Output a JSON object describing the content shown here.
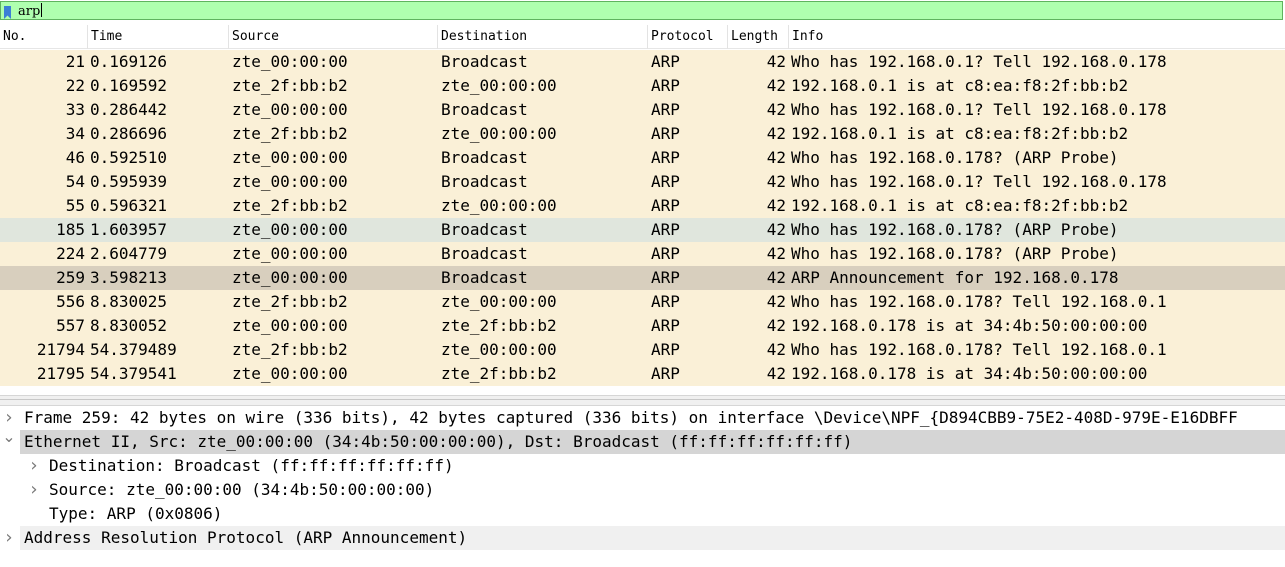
{
  "filter": {
    "value": "arp",
    "bookmark_icon": "bookmark-icon"
  },
  "packet_list": {
    "columns": [
      "No.",
      "Time",
      "Source",
      "Destination",
      "Protocol",
      "Length",
      "Info"
    ],
    "rows": [
      {
        "no": "21",
        "time": "0.169126",
        "src": "zte_00:00:00",
        "dst": "Broadcast",
        "proto": "ARP",
        "len": "42",
        "info": "Who has 192.168.0.1? Tell 192.168.0.178"
      },
      {
        "no": "22",
        "time": "0.169592",
        "src": "zte_2f:bb:b2",
        "dst": "zte_00:00:00",
        "proto": "ARP",
        "len": "42",
        "info": "192.168.0.1 is at c8:ea:f8:2f:bb:b2"
      },
      {
        "no": "33",
        "time": "0.286442",
        "src": "zte_00:00:00",
        "dst": "Broadcast",
        "proto": "ARP",
        "len": "42",
        "info": "Who has 192.168.0.1? Tell 192.168.0.178"
      },
      {
        "no": "34",
        "time": "0.286696",
        "src": "zte_2f:bb:b2",
        "dst": "zte_00:00:00",
        "proto": "ARP",
        "len": "42",
        "info": "192.168.0.1 is at c8:ea:f8:2f:bb:b2"
      },
      {
        "no": "46",
        "time": "0.592510",
        "src": "zte_00:00:00",
        "dst": "Broadcast",
        "proto": "ARP",
        "len": "42",
        "info": "Who has 192.168.0.178? (ARP Probe)"
      },
      {
        "no": "54",
        "time": "0.595939",
        "src": "zte_00:00:00",
        "dst": "Broadcast",
        "proto": "ARP",
        "len": "42",
        "info": "Who has 192.168.0.1? Tell 192.168.0.178"
      },
      {
        "no": "55",
        "time": "0.596321",
        "src": "zte_2f:bb:b2",
        "dst": "zte_00:00:00",
        "proto": "ARP",
        "len": "42",
        "info": "192.168.0.1 is at c8:ea:f8:2f:bb:b2"
      },
      {
        "no": "185",
        "time": "1.603957",
        "src": "zte_00:00:00",
        "dst": "Broadcast",
        "proto": "ARP",
        "len": "42",
        "info": "Who has 192.168.0.178? (ARP Probe)",
        "style": "hl-blue"
      },
      {
        "no": "224",
        "time": "2.604779",
        "src": "zte_00:00:00",
        "dst": "Broadcast",
        "proto": "ARP",
        "len": "42",
        "info": "Who has 192.168.0.178? (ARP Probe)"
      },
      {
        "no": "259",
        "time": "3.598213",
        "src": "zte_00:00:00",
        "dst": "Broadcast",
        "proto": "ARP",
        "len": "42",
        "info": "ARP Announcement for 192.168.0.178",
        "style": "selected"
      },
      {
        "no": "556",
        "time": "8.830025",
        "src": "zte_2f:bb:b2",
        "dst": "zte_00:00:00",
        "proto": "ARP",
        "len": "42",
        "info": "Who has 192.168.0.178? Tell 192.168.0.1"
      },
      {
        "no": "557",
        "time": "8.830052",
        "src": "zte_00:00:00",
        "dst": "zte_2f:bb:b2",
        "proto": "ARP",
        "len": "42",
        "info": "192.168.0.178 is at 34:4b:50:00:00:00"
      },
      {
        "no": "21794",
        "time": "54.379489",
        "src": "zte_2f:bb:b2",
        "dst": "zte_00:00:00",
        "proto": "ARP",
        "len": "42",
        "info": "Who has 192.168.0.178? Tell 192.168.0.1"
      },
      {
        "no": "21795",
        "time": "54.379541",
        "src": "zte_00:00:00",
        "dst": "zte_2f:bb:b2",
        "proto": "ARP",
        "len": "42",
        "info": "192.168.0.178 is at 34:4b:50:00:00:00"
      }
    ]
  },
  "details": {
    "items": [
      {
        "level": 0,
        "arrow": "collapsed",
        "style": "",
        "text": "Frame 259: 42 bytes on wire (336 bits), 42 bytes captured (336 bits) on interface \\Device\\NPF_{D894CBB9-75E2-408D-979E-E16DBFF"
      },
      {
        "level": 0,
        "arrow": "expanded",
        "style": "sel",
        "text": "Ethernet II, Src: zte_00:00:00 (34:4b:50:00:00:00), Dst: Broadcast (ff:ff:ff:ff:ff:ff)"
      },
      {
        "level": 1,
        "arrow": "collapsed",
        "style": "",
        "text": "Destination: Broadcast (ff:ff:ff:ff:ff:ff)"
      },
      {
        "level": 1,
        "arrow": "collapsed",
        "style": "",
        "text": "Source: zte_00:00:00 (34:4b:50:00:00:00)"
      },
      {
        "level": 1,
        "arrow": "none",
        "style": "",
        "text": "Type: ARP (0x0806)"
      },
      {
        "level": 0,
        "arrow": "collapsed",
        "style": "gray",
        "text": "Address Resolution Protocol (ARP Announcement)"
      }
    ]
  },
  "colors": {
    "filter_valid_bg": "#afffaf",
    "arp_row_bg": "#faf0d7",
    "selected_row_bg": "#d8cfbe",
    "highlight_row_bg": "#e0e6dd"
  }
}
